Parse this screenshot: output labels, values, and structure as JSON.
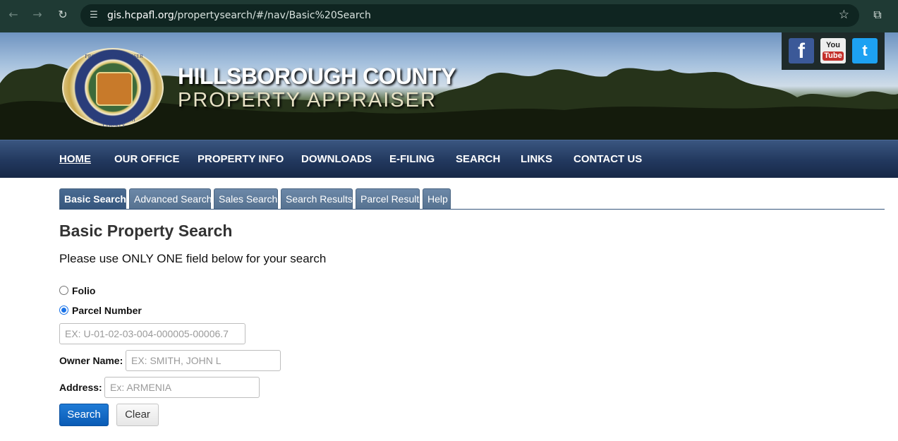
{
  "browser": {
    "url_host": "gis.hcpafl.org",
    "url_path": "/propertysearch/#/nav/Basic%20Search"
  },
  "banner": {
    "title_line1": "HILLSBOROUGH COUNTY",
    "title_line2": "PROPERTY APPRAISER",
    "seal_top_text": "PROPERTY APPRAISER",
    "seal_bottom_text": "HILLSBOROUGH COUNTY",
    "social": {
      "facebook": "f",
      "youtube_top": "You",
      "youtube_bottom": "Tube",
      "twitter": "t"
    }
  },
  "main_nav": {
    "items": [
      {
        "label": "HOME"
      },
      {
        "label": "OUR OFFICE"
      },
      {
        "label": "PROPERTY INFO"
      },
      {
        "label": "DOWNLOADS"
      },
      {
        "label": "E-FILING"
      },
      {
        "label": "SEARCH"
      },
      {
        "label": "LINKS"
      },
      {
        "label": "CONTACT US"
      }
    ]
  },
  "tabs": [
    {
      "label": "Basic Search",
      "active": true
    },
    {
      "label": "Advanced Search"
    },
    {
      "label": "Sales Search"
    },
    {
      "label": "Search Results"
    },
    {
      "label": "Parcel Result"
    },
    {
      "label": "Help"
    }
  ],
  "form": {
    "heading": "Basic Property Search",
    "instructions": "Please use ONLY ONE field below for your search",
    "radio_folio": "Folio",
    "radio_parcel": "Parcel Number",
    "selected_option": "Parcel Number",
    "parcel_placeholder": "EX: U-01-02-03-004-000005-00006.7",
    "owner_label": "Owner Name:",
    "owner_placeholder": "EX: SMITH, JOHN L",
    "address_label": "Address:",
    "address_placeholder": "Ex: ARMENIA",
    "search_button": "Search",
    "clear_button": "Clear"
  },
  "colors": {
    "nav_bg": "#22385e",
    "tab_bg": "#55718f",
    "primary_button": "#0a5bb5"
  }
}
